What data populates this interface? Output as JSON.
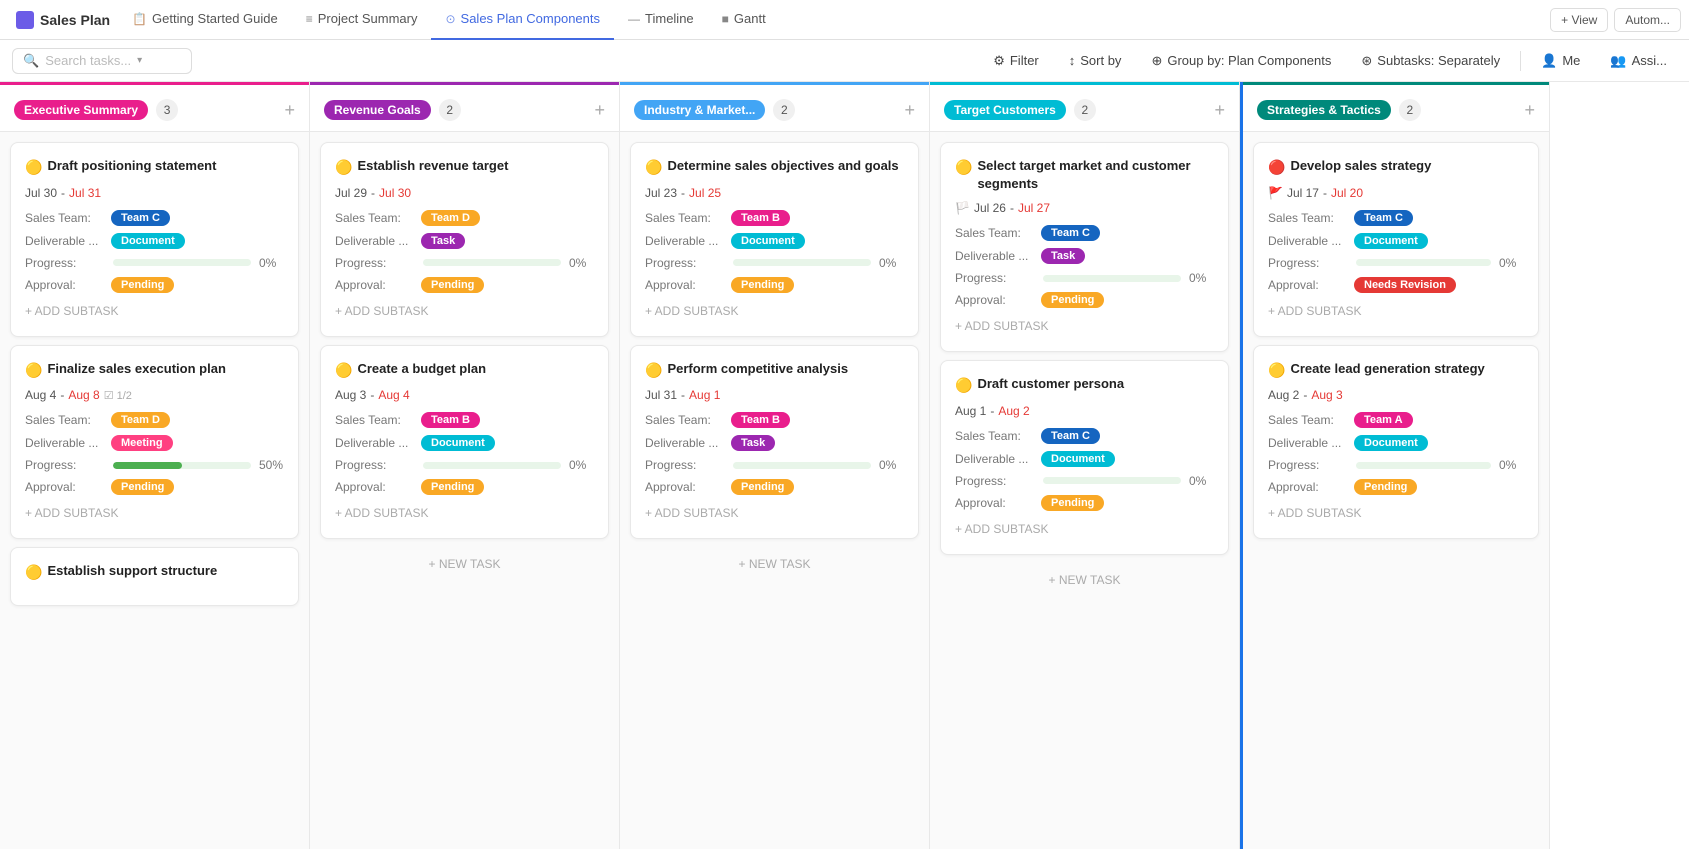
{
  "app": {
    "title": "Sales Plan",
    "logo_color": "#6c5ce7"
  },
  "nav": {
    "tabs": [
      {
        "id": "getting-started",
        "label": "Getting Started Guide",
        "icon": "📋",
        "active": false
      },
      {
        "id": "project-summary",
        "label": "Project Summary",
        "icon": "≡",
        "active": false
      },
      {
        "id": "sales-plan-components",
        "label": "Sales Plan Components",
        "icon": "⊙",
        "active": true
      },
      {
        "id": "timeline",
        "label": "Timeline",
        "icon": "—",
        "active": false
      },
      {
        "id": "gantt",
        "label": "Gantt",
        "icon": "■",
        "active": false
      }
    ],
    "view_btn": "+ View",
    "autom_btn": "Autom..."
  },
  "toolbar": {
    "search_placeholder": "Search tasks...",
    "filter_label": "Filter",
    "sort_by_label": "Sort by",
    "group_by_label": "Group by: Plan Components",
    "subtasks_label": "Subtasks: Separately",
    "me_label": "Me",
    "assign_label": "Assi..."
  },
  "columns": [
    {
      "id": "executive-summary",
      "badge_label": "Executive Summary",
      "badge_color": "#e91e8c",
      "count": 3,
      "header_top_color": "#e91e8c",
      "cards": [
        {
          "id": "card-1",
          "title": "Draft positioning statement",
          "title_icon": "🟡",
          "date_start": "Jul 30",
          "date_end": "Jul 31",
          "date_end_red": true,
          "flag": false,
          "sales_team_label": "Sales Team:",
          "sales_team_tag": "Team C",
          "sales_team_tag_class": "tag-team-c",
          "deliverable_label": "Deliverable ...",
          "deliverable_tag": "Document",
          "deliverable_tag_class": "tag-doc",
          "progress_pct": 0,
          "approval_label": "Approval:",
          "approval_tag": "Pending",
          "approval_tag_class": "tag-pending",
          "add_subtask": "+ ADD SUBTASK"
        },
        {
          "id": "card-2",
          "title": "Finalize sales execution plan",
          "title_icon": "🟡",
          "date_start": "Aug 4",
          "date_end": "Aug 8",
          "date_end_red": true,
          "subtask_check": "1/2",
          "flag": false,
          "sales_team_label": "Sales Team:",
          "sales_team_tag": "Team D",
          "sales_team_tag_class": "tag-team-d",
          "deliverable_label": "Deliverable ...",
          "deliverable_tag": "Meeting",
          "deliverable_tag_class": "tag-meeting",
          "progress_pct": 50,
          "approval_label": "Approval:",
          "approval_tag": "Pending",
          "approval_tag_class": "tag-pending",
          "add_subtask": "+ ADD SUBTASK"
        },
        {
          "id": "card-3",
          "title": "Establish support structure",
          "title_icon": "🟡",
          "date_start": "",
          "date_end": "",
          "date_end_red": false,
          "flag": false,
          "truncated": true
        }
      ]
    },
    {
      "id": "revenue-goals",
      "badge_label": "Revenue Goals",
      "badge_color": "#9c27b0",
      "count": 2,
      "header_top_color": "#9c27b0",
      "cards": [
        {
          "id": "card-4",
          "title": "Establish revenue target",
          "title_icon": "🟡",
          "date_start": "Jul 29",
          "date_end": "Jul 30",
          "date_end_red": true,
          "flag": false,
          "sales_team_label": "Sales Team:",
          "sales_team_tag": "Team D",
          "sales_team_tag_class": "tag-team-d",
          "deliverable_label": "Deliverable ...",
          "deliverable_tag": "Task",
          "deliverable_tag_class": "tag-task",
          "progress_pct": 0,
          "approval_label": "Approval:",
          "approval_tag": "Pending",
          "approval_tag_class": "tag-pending",
          "add_subtask": "+ ADD SUBTASK"
        },
        {
          "id": "card-5",
          "title": "Create a budget plan",
          "title_icon": "🟡",
          "date_start": "Aug 3",
          "date_end": "Aug 4",
          "date_end_red": true,
          "flag": false,
          "sales_team_label": "Sales Team:",
          "sales_team_tag": "Team B",
          "sales_team_tag_class": "tag-team-b",
          "deliverable_label": "Deliverable ...",
          "deliverable_tag": "Document",
          "deliverable_tag_class": "tag-doc",
          "progress_pct": 0,
          "approval_label": "Approval:",
          "approval_tag": "Pending",
          "approval_tag_class": "tag-pending",
          "add_subtask": "+ ADD SUBTASK"
        }
      ],
      "new_task": "+ NEW TASK"
    },
    {
      "id": "industry-market",
      "badge_label": "Industry & Market...",
      "badge_color": "#42a5f5",
      "count": 2,
      "header_top_color": "#42a5f5",
      "cards": [
        {
          "id": "card-6",
          "title": "Determine sales objectives and goals",
          "title_icon": "🟡",
          "date_start": "Jul 23",
          "date_end": "Jul 25",
          "date_end_red": true,
          "flag": false,
          "sales_team_label": "Sales Team:",
          "sales_team_tag": "Team B",
          "sales_team_tag_class": "tag-team-b",
          "deliverable_label": "Deliverable ...",
          "deliverable_tag": "Document",
          "deliverable_tag_class": "tag-doc",
          "progress_pct": 0,
          "approval_label": "Approval:",
          "approval_tag": "Pending",
          "approval_tag_class": "tag-pending",
          "add_subtask": "+ ADD SUBTASK"
        },
        {
          "id": "card-7",
          "title": "Perform competitive analysis",
          "title_icon": "🟡",
          "date_start": "Jul 31",
          "date_end": "Aug 1",
          "date_end_red": true,
          "flag": false,
          "sales_team_label": "Sales Team:",
          "sales_team_tag": "Team B",
          "sales_team_tag_class": "tag-team-b",
          "deliverable_label": "Deliverable ...",
          "deliverable_tag": "Task",
          "deliverable_tag_class": "tag-task",
          "progress_pct": 0,
          "approval_label": "Approval:",
          "approval_tag": "Pending",
          "approval_tag_class": "tag-pending",
          "add_subtask": "+ ADD SUBTASK"
        }
      ],
      "new_task": "+ NEW TASK"
    },
    {
      "id": "target-customers",
      "badge_label": "Target Customers",
      "badge_color": "#00bcd4",
      "count": 2,
      "header_top_color": "#00bcd4",
      "cards": [
        {
          "id": "card-8",
          "title": "Select target market and customer segments",
          "title_icon": "🟡",
          "date_start": "Jul 26",
          "date_end": "Jul 27",
          "date_end_red": true,
          "flag": true,
          "flag_color": "🏳️",
          "sales_team_label": "Sales Team:",
          "sales_team_tag": "Team C",
          "sales_team_tag_class": "tag-team-c",
          "deliverable_label": "Deliverable ...",
          "deliverable_tag": "Task",
          "deliverable_tag_class": "tag-task",
          "progress_pct": 0,
          "approval_label": "Approval:",
          "approval_tag": "Pending",
          "approval_tag_class": "tag-pending",
          "add_subtask": "+ ADD SUBTASK"
        },
        {
          "id": "card-9",
          "title": "Draft customer persona",
          "title_icon": "🟡",
          "date_start": "Aug 1",
          "date_end": "Aug 2",
          "date_end_red": true,
          "flag": false,
          "sales_team_label": "Sales Team:",
          "sales_team_tag": "Team C",
          "sales_team_tag_class": "tag-team-c",
          "deliverable_label": "Deliverable ...",
          "deliverable_tag": "Document",
          "deliverable_tag_class": "tag-doc",
          "progress_pct": 0,
          "approval_label": "Approval:",
          "approval_tag": "Pending",
          "approval_tag_class": "tag-pending",
          "add_subtask": "+ ADD SUBTASK"
        }
      ],
      "new_task": "+ NEW TASK"
    },
    {
      "id": "strategies-tactics",
      "badge_label": "Strategies & Tactics",
      "badge_color": "#00897b",
      "count": 2,
      "header_top_color": "#00897b",
      "has_left_border": true,
      "cards": [
        {
          "id": "card-10",
          "title": "Develop sales strategy",
          "title_icon": "🔴",
          "date_start": "Jul 17",
          "date_end": "Jul 20",
          "date_end_red": true,
          "flag": true,
          "flag_color": "🚩",
          "sales_team_label": "Sales Team:",
          "sales_team_tag": "Team C",
          "sales_team_tag_class": "tag-team-c",
          "deliverable_label": "Deliverable ...",
          "deliverable_tag": "Document",
          "deliverable_tag_class": "tag-doc",
          "progress_pct": 0,
          "approval_label": "Approval:",
          "approval_tag": "Needs Revision",
          "approval_tag_class": "tag-needs-revision",
          "add_subtask": "+ ADD SUBTASK"
        },
        {
          "id": "card-11",
          "title": "Create lead generation strategy",
          "title_icon": "🟡",
          "date_start": "Aug 2",
          "date_end": "Aug 3",
          "date_end_red": true,
          "flag": false,
          "sales_team_label": "Sales Team:",
          "sales_team_tag": "Team A",
          "sales_team_tag_class": "tag-team-a",
          "deliverable_label": "Deliverable ...",
          "deliverable_tag": "Document",
          "deliverable_tag_class": "tag-doc",
          "progress_pct": 0,
          "approval_label": "Approval:",
          "approval_tag": "Pending",
          "approval_tag_class": "tag-pending",
          "add_subtask": "+ ADD SUBTASK"
        }
      ]
    }
  ],
  "labels": {
    "add_subtask": "+ ADD SUBTASK",
    "new_task": "+ NEW TASK",
    "sales_team": "Sales Team:",
    "deliverable": "Deliverable ...",
    "progress": "Progress:",
    "approval": "Approval:"
  }
}
